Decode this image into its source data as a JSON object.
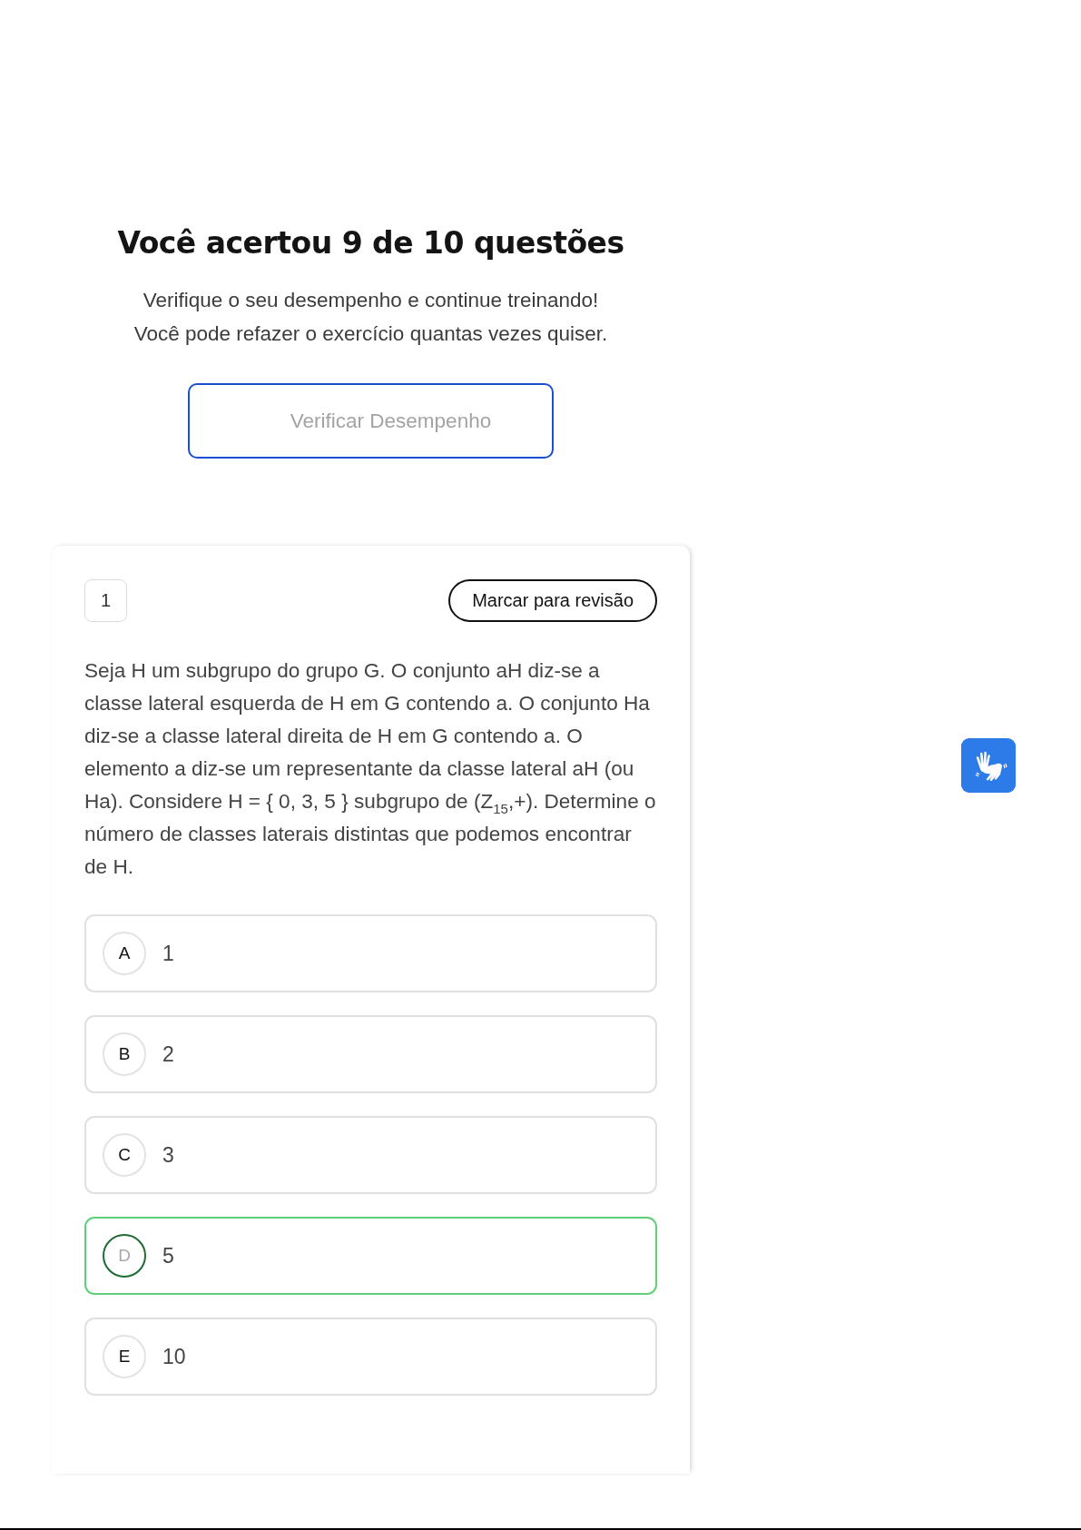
{
  "result": {
    "title": "Você acertou 9 de 10 questões",
    "message_lines": [
      "Verifique o seu desempenho e continue treinando!",
      "Você pode refazer o exercício quantas vezes quiser."
    ],
    "button": "Verificar Desempenho"
  },
  "question": {
    "number": "1",
    "review_button": "Marcar para revisão",
    "text": "Seja H um subgrupo do grupo G. O conjunto aH diz-se a classe lateral esquerda de H em G contendo a. O conjunto Ha diz-se a classe lateral direita de H em G contendo a. O elemento a diz-se um representante da classe lateral aH (ou Ha). Considere H = { 0, 3,  5 } subgrupo de (Z$_{15}$,+). Determine o número de classes laterais distintas que podemos encontrar de H.",
    "options": [
      {
        "letter": "A",
        "text": "1",
        "correct": false
      },
      {
        "letter": "B",
        "text": "2",
        "correct": false
      },
      {
        "letter": "C",
        "text": "3",
        "correct": false
      },
      {
        "letter": "D",
        "text": "5",
        "correct": true
      },
      {
        "letter": "E",
        "text": "10",
        "correct": false
      }
    ]
  }
}
